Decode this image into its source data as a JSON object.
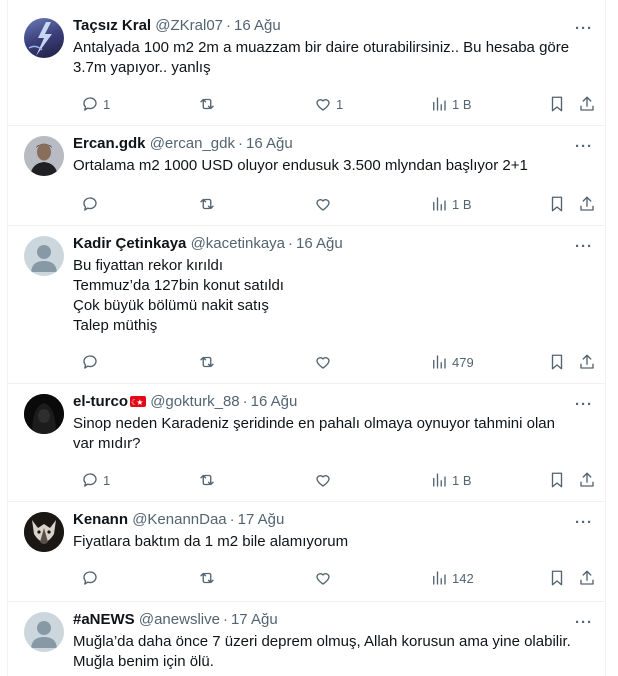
{
  "tweets": [
    {
      "name": "Taçsız Kral",
      "handle": "@ZKral07",
      "date": "16 Ağu",
      "lines": [
        "Antalyada 100 m2 2m a muazzam bir daire oturabilirsiniz.. Bu hesaba göre",
        "3.7m yapıyor.. yanlış"
      ],
      "replies": "1",
      "reposts": "",
      "likes": "1",
      "views": "1 B",
      "avatar": "lightning"
    },
    {
      "name": "Ercan.gdk",
      "handle": "@ercan_gdk",
      "date": "16 Ağu",
      "lines": [
        "Ortalama m2 1000 USD oluyor endusuk 3.500 mlyndan başlıyor 2+1"
      ],
      "replies": "",
      "reposts": "",
      "likes": "",
      "views": "1 B",
      "avatar": "photo-man"
    },
    {
      "name": "Kadir Çetinkaya",
      "handle": "@kacetinkaya",
      "date": "16 Ağu",
      "lines": [
        "Bu fiyattan rekor kırıldı",
        "Temmuz’da 127bin konut satıldı",
        "Çok büyük bölümü nakit satış",
        "Talep müthiş"
      ],
      "replies": "",
      "reposts": "",
      "likes": "",
      "views": "479",
      "avatar": "default"
    },
    {
      "name": "el-turco",
      "handle": "@gokturk_88",
      "date": "16 Ağu",
      "lines": [
        "Sinop neden Karadeniz şeridinde en pahalı olmaya oynuyor tahmini olan",
        "var mıdır?"
      ],
      "replies": "1",
      "reposts": "",
      "likes": "",
      "views": "1 B",
      "avatar": "hooded"
    },
    {
      "name": "Kenann",
      "handle": "@KenannDaa",
      "date": "17 Ağu",
      "lines": [
        "Fiyatlara baktım da 1 m2 bile alamıyorum"
      ],
      "replies": "",
      "reposts": "",
      "likes": "",
      "views": "142",
      "avatar": "wolf"
    },
    {
      "name": "#aNEWS",
      "handle": "@anewslive",
      "date": "17 Ağu",
      "lines": [
        "Muğla’da daha önce 7 üzeri deprem olmuş, Allah korusun ama yine olabilir.",
        "Muğla benim için ölü."
      ],
      "replies": "",
      "reposts": "",
      "likes": "",
      "views": "",
      "avatar": "default"
    }
  ],
  "ui": {
    "more": "···"
  },
  "colors": {
    "text": "#0f1419",
    "secondary": "#536471",
    "border": "#eff3f4",
    "flag_red": "#e30a17"
  }
}
